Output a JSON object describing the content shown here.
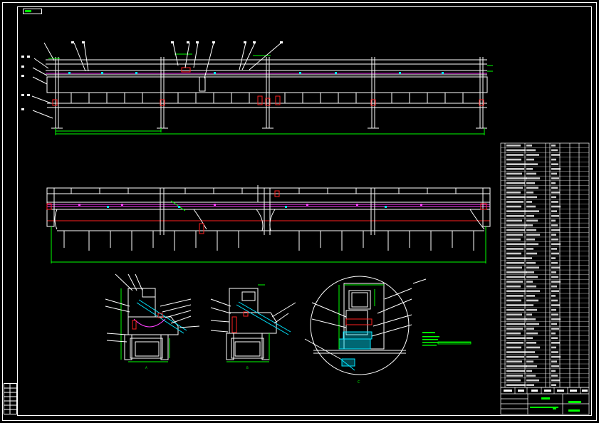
{
  "title_stamp": "■■■",
  "view_labels": {
    "section_a": "A",
    "section_b": "B",
    "detail_c": "C"
  },
  "colors": {
    "background": "#000000",
    "frame": "#ffffff",
    "structure": "#ffffff",
    "dimension": "#00ff00",
    "accent_red": "#ff2020",
    "accent_magenta": "#ff40ff",
    "accent_cyan": "#00e5ff",
    "accent_yellow": "#ffff00"
  }
}
